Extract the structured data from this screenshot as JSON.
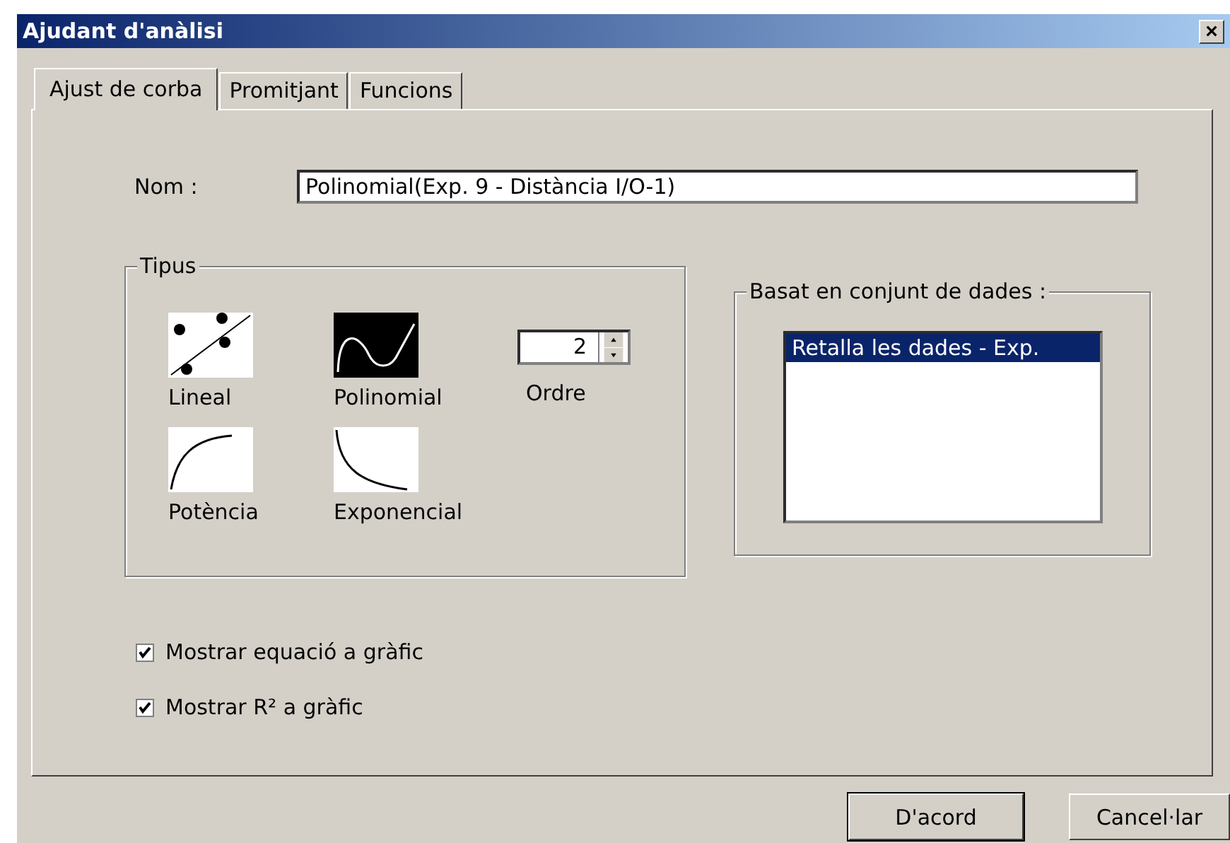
{
  "window": {
    "title": "Ajudant d'anàlisi",
    "close": "×"
  },
  "tabs": [
    {
      "label": "Ajust de corba",
      "selected": true
    },
    {
      "label": "Promitjant",
      "selected": false
    },
    {
      "label": "Funcions",
      "selected": false
    }
  ],
  "name_field": {
    "label": "Nom :",
    "value": "Polinomial(Exp. 9 - Distància I/O-1)"
  },
  "type_group": {
    "title": "Tipus",
    "types": [
      {
        "kind": "linear",
        "label": "Lineal",
        "selected": false
      },
      {
        "kind": "polynomial",
        "label": "Polinomial",
        "selected": true
      },
      {
        "kind": "power",
        "label": "Potència",
        "selected": false
      },
      {
        "kind": "exponential",
        "label": "Exponencial",
        "selected": false
      }
    ],
    "order": {
      "value": "2",
      "label": "Ordre"
    }
  },
  "dataset_group": {
    "title": "Basat en conjunt de dades :",
    "items": [
      {
        "label": "Retalla les dades - Exp.",
        "selected": true
      }
    ]
  },
  "checkboxes": [
    {
      "label": "Mostrar equació a gràfic",
      "checked": true
    },
    {
      "label": "Mostrar R² a gràfic",
      "checked": true
    }
  ],
  "buttons": [
    {
      "label": "D'acord",
      "default": true
    },
    {
      "label": "Cancel·lar",
      "default": false
    }
  ]
}
